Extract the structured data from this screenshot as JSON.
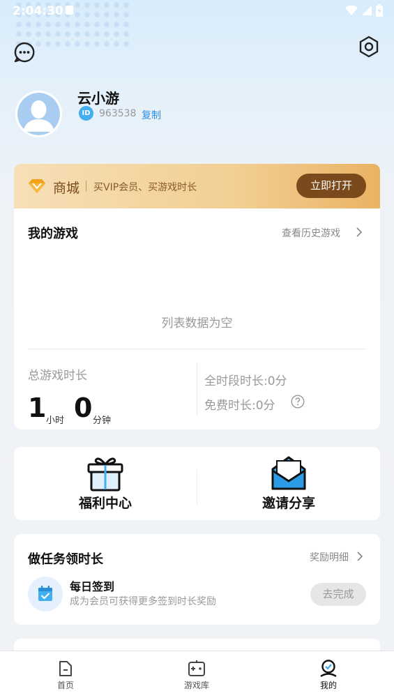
{
  "status_bar": {
    "time": "2:04:30"
  },
  "profile": {
    "username": "云小游",
    "id_badge": "ID",
    "user_id": "963538",
    "copy_label": "复制"
  },
  "mall": {
    "title": "商城",
    "description": "买VIP会员、买游戏时长",
    "button": "立即打开"
  },
  "my_games": {
    "title": "我的游戏",
    "history_link": "查看历史游戏",
    "empty_text": "列表数据为空",
    "total_label": "总游戏时长",
    "hours": "1",
    "hours_unit": "小时",
    "minutes": "0",
    "minutes_unit": "分钟",
    "all_period": "全时段时长:0分",
    "free_time": "免费时长:0分"
  },
  "features": [
    {
      "label": "福利中心",
      "icon": "gift-icon"
    },
    {
      "label": "邀请分享",
      "icon": "envelope-icon"
    }
  ],
  "tasks": {
    "title": "做任务领时长",
    "detail_link": "奖励明细",
    "items": [
      {
        "name": "每日签到",
        "desc": "成为会员可获得更多签到时长奖励",
        "button": "去完成",
        "icon": "calendar-check-icon"
      }
    ]
  },
  "tabbar": [
    {
      "label": "首页",
      "icon": "home-icon",
      "active": false
    },
    {
      "label": "游戏库",
      "icon": "gamepad-icon",
      "active": false
    },
    {
      "label": "我的",
      "icon": "profile-icon",
      "active": true
    }
  ],
  "colors": {
    "accent_blue": "#2f8de4",
    "mall_brown": "#7a4a1c",
    "mall_gold": "#eab364"
  }
}
